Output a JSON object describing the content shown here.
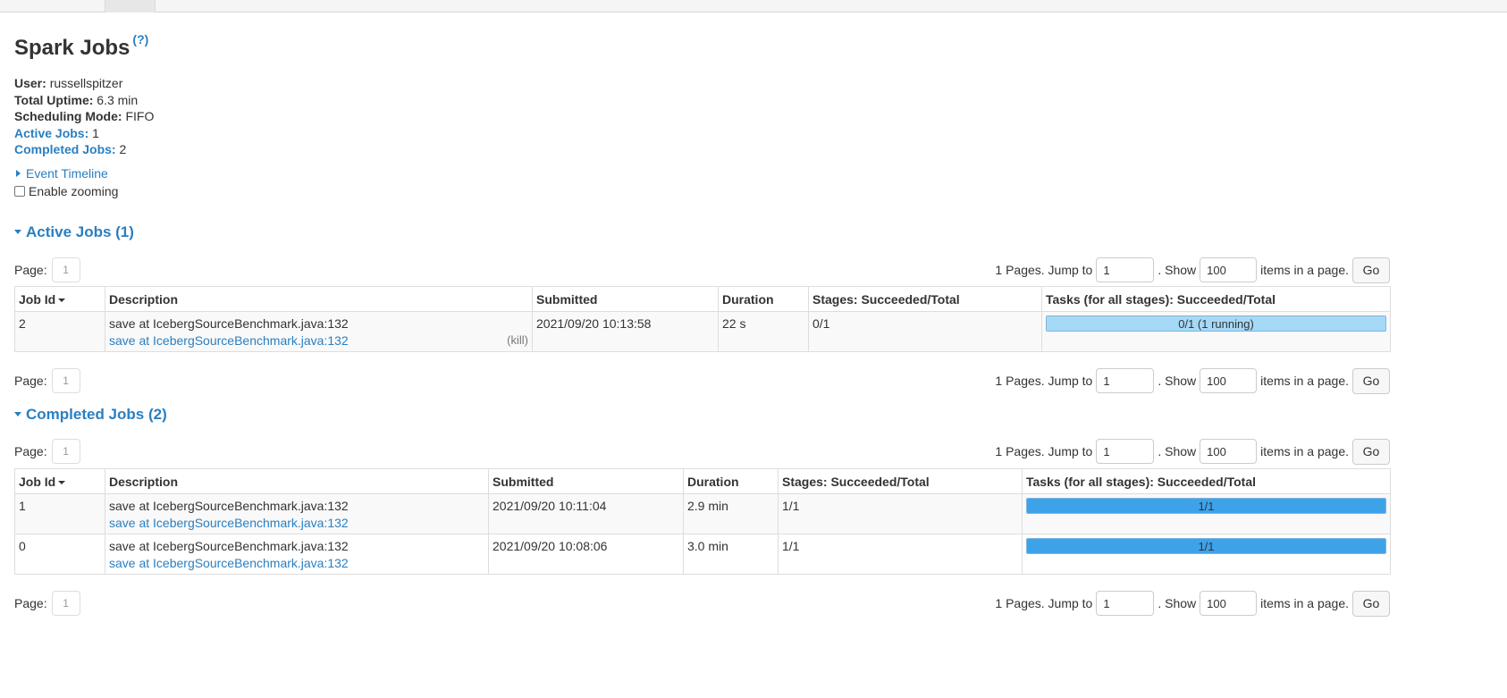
{
  "page": {
    "title": "Spark Jobs",
    "help": "?",
    "summary": {
      "user_label": "User:",
      "user": "russellspitzer",
      "uptime_label": "Total Uptime:",
      "uptime": "6.3 min",
      "mode_label": "Scheduling Mode:",
      "mode": "FIFO",
      "active_label": "Active Jobs:",
      "active": "1",
      "completed_label": "Completed Jobs:",
      "completed": "2"
    },
    "event_timeline": "Event Timeline",
    "enable_zooming": "Enable zooming"
  },
  "pager": {
    "page_label": "Page:",
    "page_num": "1",
    "pages_text": "1 Pages. Jump to",
    "jump_value": "1",
    "show_text": ". Show",
    "show_value": "100",
    "items_text": "items in a page.",
    "go": "Go"
  },
  "columns": [
    "Job Id",
    "Description",
    "Submitted",
    "Duration",
    "Stages: Succeeded/Total",
    "Tasks (for all stages): Succeeded/Total"
  ],
  "active": {
    "heading": "Active Jobs (1)",
    "rows": [
      {
        "job_id": "2",
        "desc": "save at IcebergSourceBenchmark.java:132",
        "desc_link": "save at IcebergSourceBenchmark.java:132",
        "kill": "(kill)",
        "submitted": "2021/09/20 10:13:58",
        "duration": "22 s",
        "stages": "0/1",
        "tasks": "0/1 (1 running)",
        "tasks_done": 0,
        "tasks_running": 1,
        "tasks_total": 1
      }
    ]
  },
  "completed": {
    "heading": "Completed Jobs (2)",
    "rows": [
      {
        "job_id": "1",
        "desc": "save at IcebergSourceBenchmark.java:132",
        "desc_link": "save at IcebergSourceBenchmark.java:132",
        "submitted": "2021/09/20 10:11:04",
        "duration": "2.9 min",
        "stages": "1/1",
        "tasks": "1/1",
        "tasks_done": 1,
        "tasks_total": 1
      },
      {
        "job_id": "0",
        "desc": "save at IcebergSourceBenchmark.java:132",
        "desc_link": "save at IcebergSourceBenchmark.java:132",
        "submitted": "2021/09/20 10:08:06",
        "duration": "3.0 min",
        "stages": "1/1",
        "tasks": "1/1",
        "tasks_done": 1,
        "tasks_total": 1
      }
    ]
  },
  "colors": {
    "link": "#2a7fc1",
    "progress_complete": "#3ea2e9",
    "progress_running": "#a5d9f6"
  }
}
